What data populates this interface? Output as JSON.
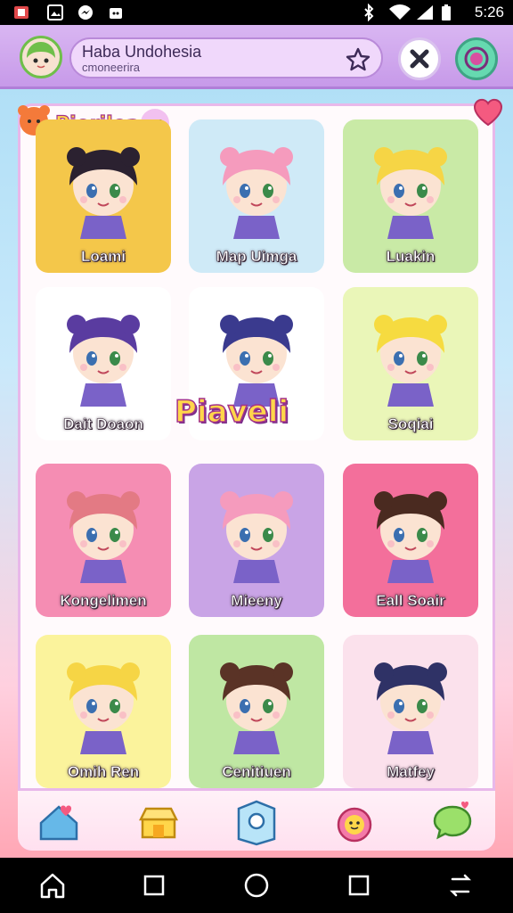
{
  "status_bar": {
    "time": "5:26"
  },
  "header": {
    "title": "Haba Undohesia",
    "subtitle": "cmoneerira"
  },
  "banner": {
    "label": "Pioriloa"
  },
  "featured": {
    "logo": "Piaveli"
  },
  "cards": [
    {
      "name": "Loami",
      "bg": "#f4c74a",
      "hair": "#2b2130"
    },
    {
      "name": "Map Uimga",
      "bg": "#cfeaf7",
      "hair": "#f59bbd"
    },
    {
      "name": "Luakin",
      "bg": "#c9eaa6",
      "hair": "#f6d545"
    },
    {
      "name": "Dait Doaon",
      "bg": "#ffffff",
      "hair": "#5a3ca0"
    },
    {
      "name": "",
      "bg": "#ffffff",
      "hair": "#3a3a8e"
    },
    {
      "name": "Soqiai",
      "bg": "#eaf6b8",
      "hair": "#f6db40"
    },
    {
      "name": "Kongelimen",
      "bg": "#f58db3",
      "hair": "#e37a84"
    },
    {
      "name": "Mieeny",
      "bg": "#c9a4e6",
      "hair": "#f59bbd"
    },
    {
      "name": "Eall Soair",
      "bg": "#f36f9b",
      "hair": "#4a2a20"
    },
    {
      "name": "Omih Ren",
      "bg": "#fbf39c",
      "hair": "#f6d545"
    },
    {
      "name": "Cenitiuen",
      "bg": "#bfe7a3",
      "hair": "#5a3326"
    },
    {
      "name": "Matfey",
      "bg": "#fbe1ec",
      "hair": "#2f3266"
    }
  ],
  "tabs": [
    {
      "icon": "house-heart-icon"
    },
    {
      "icon": "shop-icon"
    },
    {
      "icon": "search-map-icon"
    },
    {
      "icon": "pet-icon"
    },
    {
      "icon": "chat-icon"
    }
  ],
  "colors": {
    "header": "#c79ae9",
    "accent_green": "#66d9b0",
    "panel_border": "#e8b8ea"
  }
}
